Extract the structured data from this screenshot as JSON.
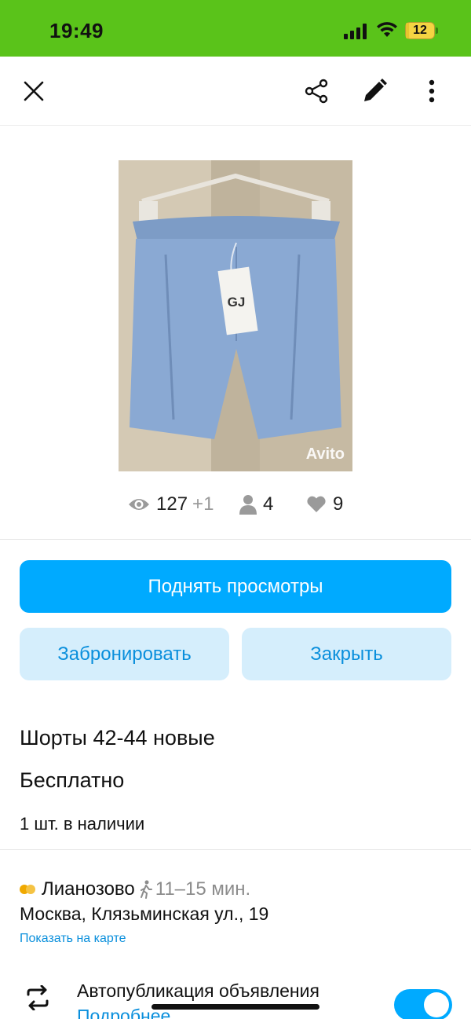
{
  "status_bar": {
    "time": "19:49",
    "battery_label": "12",
    "battery_level": 0.12,
    "background": "#5ac31a"
  },
  "toolbar": {
    "icons": [
      "close-icon",
      "share-icon",
      "edit-icon",
      "more-vertical-icon"
    ]
  },
  "listing": {
    "photo_watermark": "Avito",
    "photo_tag_text": "GJ",
    "stats": {
      "views": "127",
      "views_new": "+1",
      "contacts": "4",
      "favorites": "9"
    },
    "title": "Шорты 42-44 новые",
    "price": "Бесплатно",
    "stock": "1 шт. в наличии"
  },
  "actions": {
    "boost_label": "Поднять просмотры",
    "book_label": "Забронировать",
    "close_label": "Закрыть"
  },
  "location": {
    "metro": "Лианозово",
    "walk_time": "11–15 мин.",
    "address": "Москва, Клязьминская ул., 19",
    "map_link": "Показать на карте",
    "metro_colors": [
      "#f0a900",
      "#f5c343"
    ]
  },
  "autopublish": {
    "title": "Автопубликация объявления",
    "more_link": "Подробнее",
    "enabled": true
  },
  "colors": {
    "accent": "#00aaff",
    "secondary_bg": "#d5eefc",
    "link": "#0a8fdc"
  }
}
